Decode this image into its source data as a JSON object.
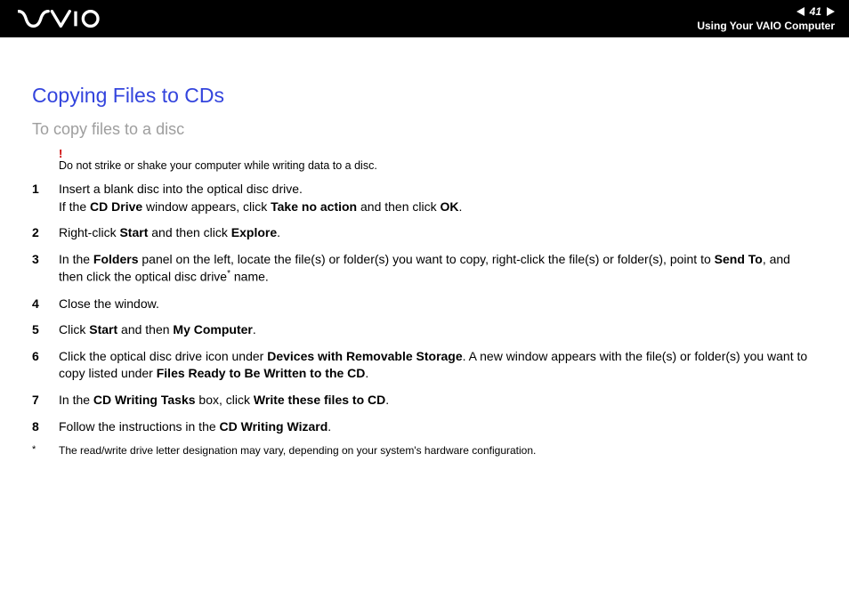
{
  "header": {
    "page_number": "41",
    "section": "Using Your VAIO Computer"
  },
  "title": "Copying Files to CDs",
  "subtitle": "To copy files to a disc",
  "warning": {
    "mark": "!",
    "text": "Do not strike or shake your computer while writing data to a disc."
  },
  "steps": [
    {
      "num": "1",
      "parts": [
        {
          "t": "Insert a blank disc into the optical disc drive."
        },
        {
          "br": true
        },
        {
          "t": "If the "
        },
        {
          "b": "CD Drive"
        },
        {
          "t": " window appears, click "
        },
        {
          "b": "Take no action"
        },
        {
          "t": " and then click "
        },
        {
          "b": "OK"
        },
        {
          "t": "."
        }
      ]
    },
    {
      "num": "2",
      "parts": [
        {
          "t": "Right-click "
        },
        {
          "b": "Start"
        },
        {
          "t": " and then click "
        },
        {
          "b": "Explore"
        },
        {
          "t": "."
        }
      ]
    },
    {
      "num": "3",
      "parts": [
        {
          "t": "In the "
        },
        {
          "b": "Folders"
        },
        {
          "t": " panel on the left, locate the file(s) or folder(s) you want to copy, right-click the file(s) or folder(s), point to "
        },
        {
          "b": "Send To"
        },
        {
          "t": ", and then click the optical disc drive"
        },
        {
          "sup": "*"
        },
        {
          "t": " name."
        }
      ]
    },
    {
      "num": "4",
      "parts": [
        {
          "t": "Close the window."
        }
      ]
    },
    {
      "num": "5",
      "parts": [
        {
          "t": "Click "
        },
        {
          "b": "Start"
        },
        {
          "t": " and then "
        },
        {
          "b": "My Computer"
        },
        {
          "t": "."
        }
      ]
    },
    {
      "num": "6",
      "parts": [
        {
          "t": "Click the optical disc drive icon under "
        },
        {
          "b": "Devices with Removable Storage"
        },
        {
          "t": ". A new window appears with the file(s) or folder(s) you want to copy listed under "
        },
        {
          "b": "Files Ready to Be Written to the CD"
        },
        {
          "t": "."
        }
      ]
    },
    {
      "num": "7",
      "parts": [
        {
          "t": "In the "
        },
        {
          "b": "CD Writing Tasks"
        },
        {
          "t": " box, click "
        },
        {
          "b": "Write these files to CD"
        },
        {
          "t": "."
        }
      ]
    },
    {
      "num": "8",
      "parts": [
        {
          "t": "Follow the instructions in the "
        },
        {
          "b": "CD Writing Wizard"
        },
        {
          "t": "."
        }
      ]
    }
  ],
  "footnote": {
    "mark": "*",
    "text": "The read/write drive letter designation may vary, depending on your system's hardware configuration."
  }
}
